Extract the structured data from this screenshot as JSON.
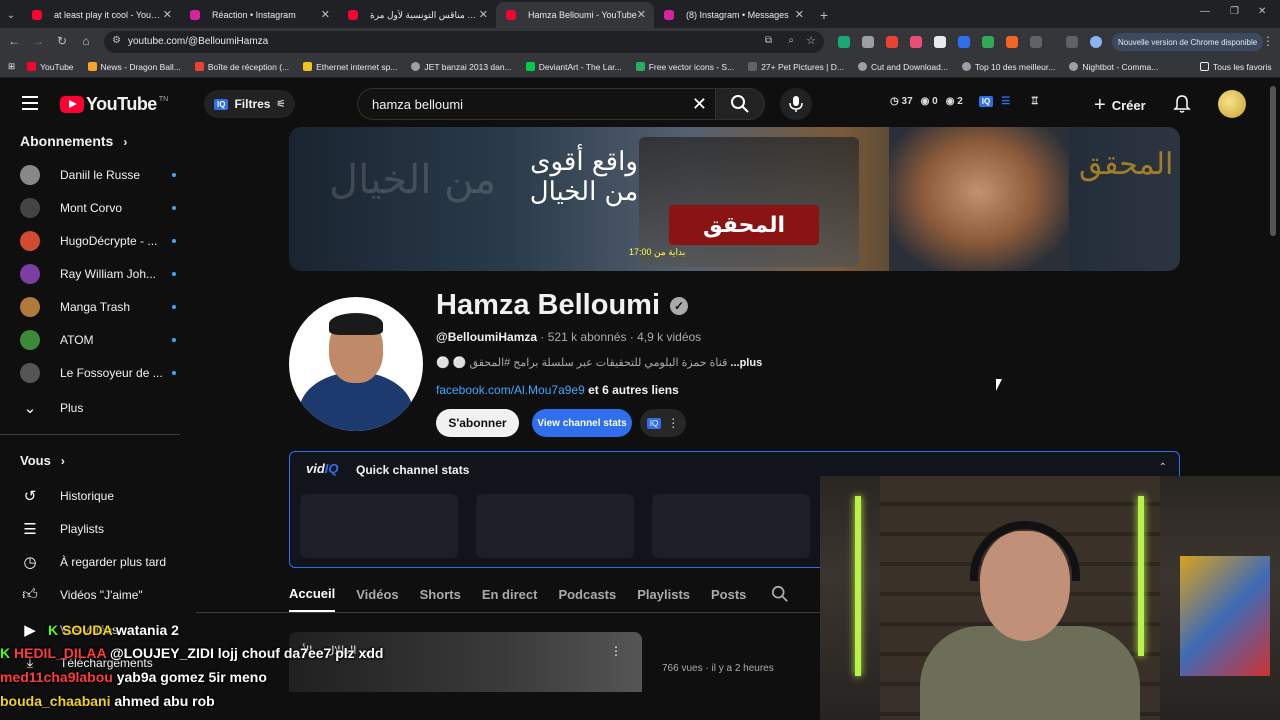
{
  "browser": {
    "tabs": [
      {
        "title": "at least play it cool - YouTube",
        "color": "#ff0033"
      },
      {
        "title": "Réaction • Instagram",
        "color": "#d6249f"
      },
      {
        "title": "مناقس التونسية لأول مرة 🎤 TNEG",
        "color": "#ff0033"
      },
      {
        "title": "Hamza Belloumi - YouTube",
        "color": "#ff0033",
        "active": true
      },
      {
        "title": "(8) Instagram • Messages",
        "color": "#d6249f"
      }
    ],
    "url": "youtube.com/@BelloumiHamza",
    "update_label": "Nouvelle version de Chrome disponible",
    "bookmarks": [
      {
        "label": "YouTube",
        "color": "#ff0033"
      },
      {
        "label": "News - Dragon Ball...",
        "color": "#f5a623"
      },
      {
        "label": "Boîte de réception (...",
        "color": "#ea4335"
      },
      {
        "label": "Ethernet internet sp...",
        "color": "#f0c419"
      },
      {
        "label": "JET banzai 2013 dan...",
        "color": "#9aa0a6"
      },
      {
        "label": "DeviantArt - The Lar...",
        "color": "#05cc47"
      },
      {
        "label": "Free vector icons - S...",
        "color": "#27ae60"
      },
      {
        "label": "27+ Pet Pictures | D...",
        "color": "#5f6368"
      },
      {
        "label": "Cut and Download...",
        "color": "#9aa0a6"
      },
      {
        "label": "Top 10 des meilleur...",
        "color": "#9aa0a6"
      },
      {
        "label": "Nightbot - Comma...",
        "color": "#9aa0a6"
      }
    ],
    "bookmarks_all": "Tous les favoris"
  },
  "header": {
    "logo_text": "YouTube",
    "logo_country": "TN",
    "filters_label": "Filtres",
    "search_query": "hamza belloumi",
    "stats": {
      "s1": "37",
      "s2": "0",
      "s3": "2"
    },
    "create_label": "Créer"
  },
  "sidebar": {
    "subscriptions_title": "Abonnements",
    "subscriptions": [
      {
        "label": "Daniil le Russe",
        "color": "#888"
      },
      {
        "label": "Mont Corvo",
        "color": "#444"
      },
      {
        "label": "HugoDécrypte - ...",
        "color": "#d24b2f"
      },
      {
        "label": "Ray William Joh...",
        "color": "#7a3fa0"
      },
      {
        "label": "Manga Trash",
        "color": "#b07a3a"
      },
      {
        "label": "ATOM",
        "color": "#3a8a3a"
      },
      {
        "label": "Le Fossoyeur de ...",
        "color": "#555"
      }
    ],
    "more_label": "Plus",
    "you_title": "Vous",
    "you_items": [
      {
        "label": "Historique",
        "icon": "history-icon"
      },
      {
        "label": "Playlists",
        "icon": "playlists-icon"
      },
      {
        "label": "À regarder plus tard",
        "icon": "watch-later-icon"
      },
      {
        "label": "Vidéos \"J'aime\"",
        "icon": "like-icon"
      },
      {
        "label": "Vos vidéos",
        "icon": "your-videos-icon"
      },
      {
        "label": "Téléchargements",
        "icon": "download-icon"
      }
    ]
  },
  "channel": {
    "name": "Hamza Belloumi",
    "handle": "@BelloumiHamza",
    "subscribers": " · 521 k abonnés · 4,9 k vidéos",
    "description": "قناة حمزة البلومي للتحقيقات عبر سلسلة برامج #المحقق",
    "description_prefix": "⚪ ⚪ ",
    "more": "...plus",
    "link": "facebook.com/Al.Mou7a9e9",
    "other_links": " et 6 autres liens",
    "subscribe_label": "S'abonner",
    "stats_button_label": "View channel stats",
    "banner_title": "واقع أقوى من الخيال",
    "banner_logo": "المحقق",
    "banner_time": "بداية من 17:00",
    "banner_left": "من الخيال",
    "banner_right": "المحقق"
  },
  "vidiq": {
    "brand_vid": "vid",
    "brand_iq": "IQ",
    "title": "Quick channel stats"
  },
  "tabs": [
    "Accueil",
    "Vidéos",
    "Shorts",
    "En direct",
    "Podcasts",
    "Playlists",
    "Posts"
  ],
  "video": {
    "thumb_text": "بين الظلال .. الأ",
    "meta": "766 vues · il y a 2 heures"
  },
  "chat": [
    {
      "user": "",
      "text": "watania 2",
      "prefix": "SOUDA"
    },
    {
      "user": "HEDIL_DILAA",
      "text": "@LOUJEY_ZIDI lojj chouf da7ee7 plz xdd"
    },
    {
      "user": "med11cha9labou",
      "text": "yab9a gomez 5ir meno"
    },
    {
      "user": "bouda_chaabani",
      "text": "ahmed abu rob"
    }
  ]
}
